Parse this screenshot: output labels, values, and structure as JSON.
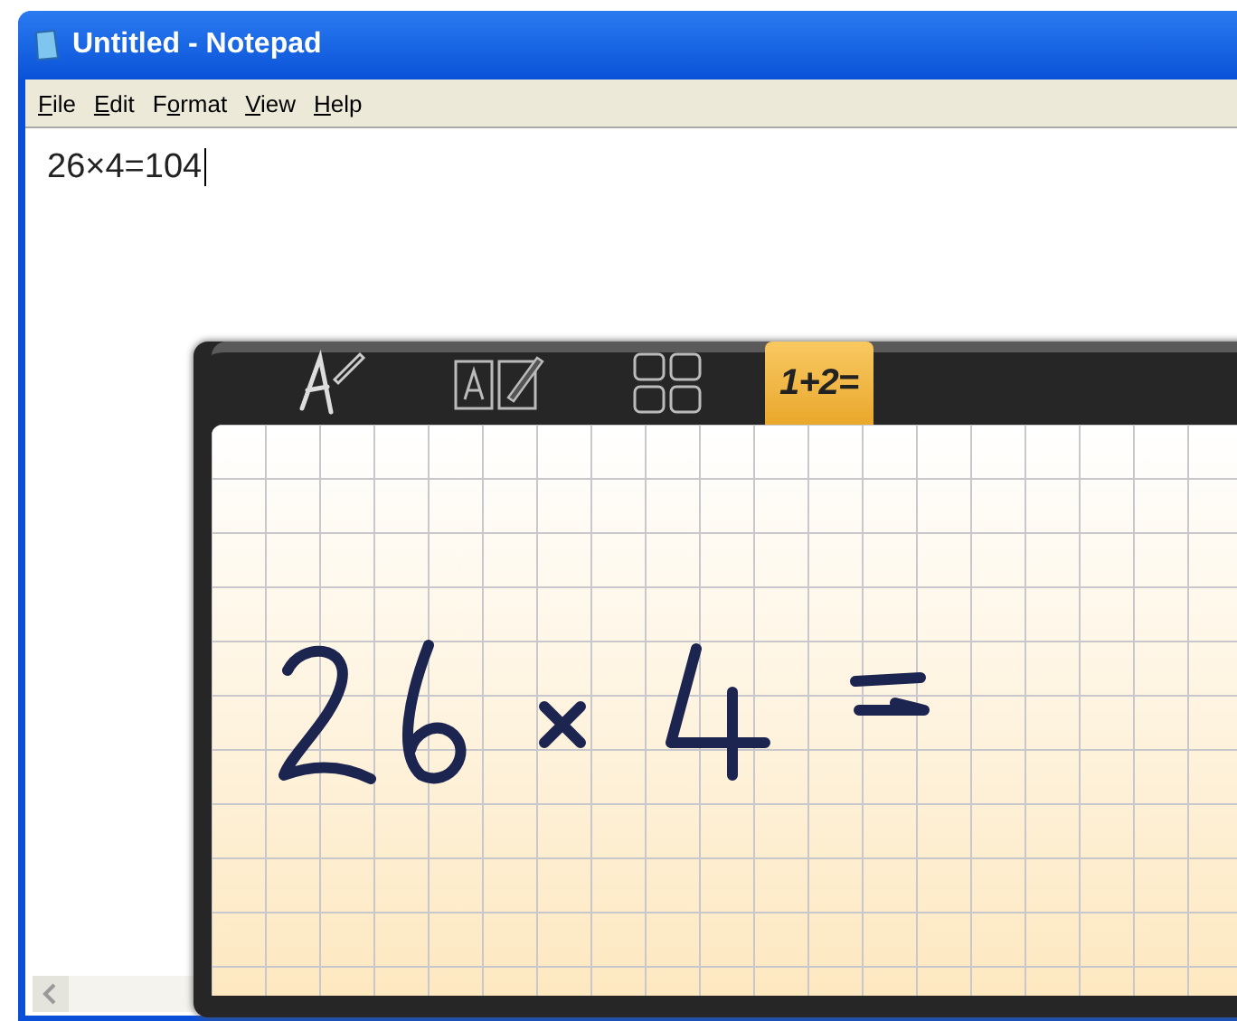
{
  "window": {
    "title": "Untitled - Notepad"
  },
  "menu": [
    {
      "segments": [
        {
          "text": "F",
          "underlined": true
        },
        {
          "text": "ile",
          "underlined": false
        }
      ]
    },
    {
      "segments": [
        {
          "text": "E",
          "underlined": true
        },
        {
          "text": "dit",
          "underlined": false
        }
      ]
    },
    {
      "segments": [
        {
          "text": "F",
          "underlined": false
        },
        {
          "text": "o",
          "underlined": true
        },
        {
          "text": "rmat",
          "underlined": false
        }
      ]
    },
    {
      "segments": [
        {
          "text": "V",
          "underlined": true
        },
        {
          "text": "iew",
          "underlined": false
        }
      ]
    },
    {
      "segments": [
        {
          "text": "H",
          "underlined": true
        },
        {
          "text": "elp",
          "underlined": false
        }
      ]
    }
  ],
  "document": {
    "text": "26×4=104"
  },
  "input_panel": {
    "tabs": [
      {
        "kind": "write",
        "selected": false
      },
      {
        "kind": "text",
        "selected": false
      },
      {
        "kind": "symbols",
        "selected": false
      },
      {
        "kind": "math",
        "label": "1+2=",
        "selected": true
      }
    ]
  }
}
